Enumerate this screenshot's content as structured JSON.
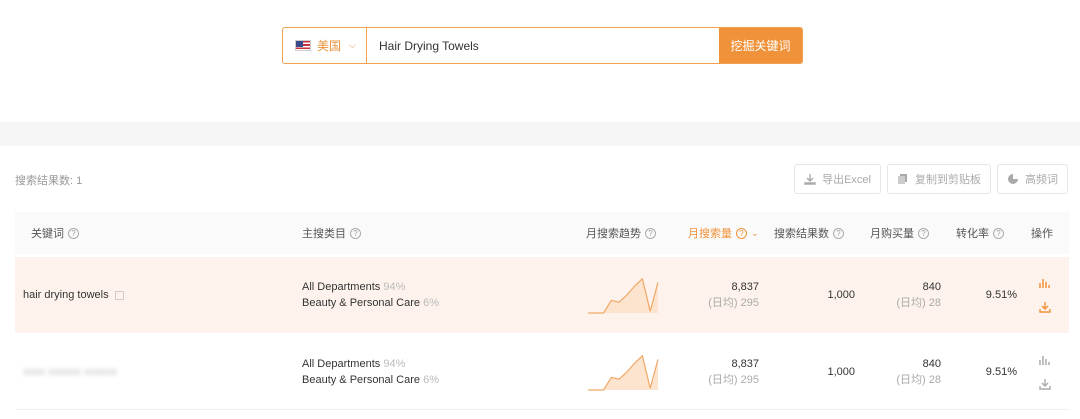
{
  "search": {
    "country": "美国",
    "keyword": "Hair Drying Towels",
    "button": "挖掘关键词"
  },
  "results": {
    "count_label": "搜索结果数: 1"
  },
  "tools": {
    "export": "导出Excel",
    "copy": "复制到剪贴板",
    "frequent": "高频词"
  },
  "table": {
    "headers": {
      "keyword": "关键词",
      "category": "主搜类目",
      "trend": "月搜索趋势",
      "monthly_search": "月搜索量",
      "result_count": "搜索结果数",
      "monthly_purchase": "月购买量",
      "conversion": "转化率",
      "actions": "操作"
    },
    "rows": [
      {
        "keyword": "hair drying towels",
        "cat1_name": "All Departments",
        "cat1_pct": "94%",
        "cat2_name": "Beauty & Personal Care",
        "cat2_pct": "6%",
        "trend": [
          0,
          0,
          0,
          0.35,
          0.3,
          0.5,
          0.75,
          0.95,
          0.05,
          0.85
        ],
        "monthly_search": "8,837",
        "daily_search": "(日均) 295",
        "result_count": "1,000",
        "monthly_purchase": "840",
        "daily_purchase": "(日均) 28",
        "conversion": "9.51%"
      },
      {
        "keyword": "xxxx xxxxxx xxxxxx",
        "cat1_name": "All Departments",
        "cat1_pct": "94%",
        "cat2_name": "Beauty & Personal Care",
        "cat2_pct": "6%",
        "trend": [
          0,
          0,
          0,
          0.35,
          0.3,
          0.5,
          0.75,
          0.95,
          0.05,
          0.85
        ],
        "monthly_search": "8,837",
        "daily_search": "(日均) 295",
        "result_count": "1,000",
        "monthly_purchase": "840",
        "daily_purchase": "(日均) 28",
        "conversion": "9.51%"
      }
    ]
  },
  "colors": {
    "accent": "#f0923a",
    "row_highlight": "#fdf3ec",
    "trend_line": "#f0a868",
    "trend_fill": "#fde4cf"
  }
}
